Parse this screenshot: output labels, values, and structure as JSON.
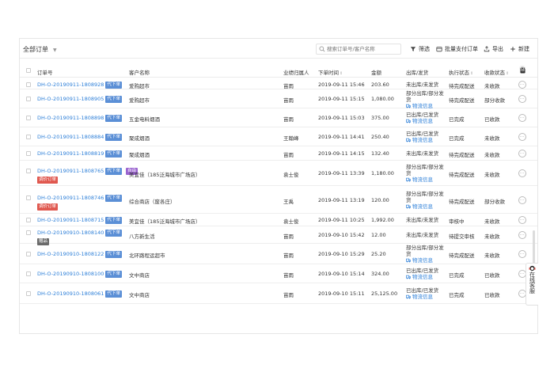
{
  "toolbar": {
    "filter_label": "全部订单",
    "search_placeholder": "搜索订单号/客户名称",
    "btn_filter": "筛选",
    "btn_batch_pay": "批量支付订单",
    "btn_export": "导出",
    "btn_new": "新建"
  },
  "columns": {
    "order_no": "订单号",
    "customer": "客户名称",
    "owner": "业绩归属人",
    "time": "下单时间",
    "amount": "金额",
    "ship": "出库/发货",
    "exec": "执行状态",
    "pay": "收款状态"
  },
  "logistics_label": "物流信息",
  "service_text": "在线客服",
  "colors": {
    "link": "#2d7fd8",
    "badge_blue": "#5b8fd6",
    "badge_red": "#e0584f",
    "badge_purple": "#9a63cf",
    "badge_dark": "#6a6a6a"
  },
  "rows": [
    {
      "order_no": "DH-O-20190911-1808928",
      "badge": "代下单",
      "customer": "爱购超市",
      "owner": "苗雨",
      "time": "2019-09-11 15:46",
      "amount": "203.60",
      "ship": "未出库/未发货",
      "exec": "待完成配送",
      "pay": "未收款"
    },
    {
      "order_no": "DH-O-20190911-1808905",
      "badge": "代下单",
      "customer": "爱购超市",
      "owner": "苗雨",
      "time": "2019-09-11 15:15",
      "amount": "1,080.00",
      "ship": "部分出库/部分发货",
      "exec": "待完成配送",
      "pay": "部分收款"
    },
    {
      "order_no": "DH-O-20190911-1808898",
      "badge": "代下单",
      "customer": "五金电料烟酒",
      "owner": "苗雨",
      "time": "2019-09-11 15:03",
      "amount": "375.00",
      "ship": "已出库/已发货",
      "exec": "已完成",
      "pay": "已收款"
    },
    {
      "order_no": "DH-O-20190911-1808884",
      "badge": "代下单",
      "customer": "聚成烟酒",
      "owner": "王翰峰",
      "time": "2019-09-11 14:41",
      "amount": "250.40",
      "ship": "已出库/已发货",
      "exec": "已完成",
      "pay": "未收款"
    },
    {
      "order_no": "DH-O-20190911-1808819",
      "badge": "代下单",
      "customer": "聚成烟酒",
      "owner": "苗雨",
      "time": "2019-09-11 14:15",
      "amount": "132.40",
      "ship": "未出库/未发货",
      "exec": "待完成配送",
      "pay": "未收款"
    },
    {
      "order_no": "DH-O-20190911-1808765",
      "badge": "代下单",
      "badge3": "自由",
      "tag2": "调价订单",
      "customer": "美宜佳（185泛海城市广场店）",
      "owner": "袁士俊",
      "time": "2019-09-11 13:39",
      "amount": "1,180.00",
      "ship": "部分出库/部分发货",
      "exec": "待完成配送",
      "pay": "未收款"
    },
    {
      "order_no": "DH-O-20190911-1808746",
      "badge": "代下单",
      "tag2": "调价订单",
      "customer": "综合商店（废各庄）",
      "owner": "王禹",
      "time": "2019-09-11 13:19",
      "amount": "120.00",
      "ship": "部分出库/部分发货",
      "exec": "待完成配送",
      "pay": "部分收款"
    },
    {
      "order_no": "DH-O-20190911-1808715",
      "badge": "代下单",
      "customer": "美宜佳（185泛海城市广场店）",
      "owner": "袁士俊",
      "time": "2019-09-11 10:25",
      "amount": "1,992.00",
      "ship": "未出库/未发货",
      "exec": "审核中",
      "pay": "未收款"
    },
    {
      "order_no": "DH-O-20190910-1808140",
      "badge": "代下单",
      "tag2": "赠品",
      "customer": "八方新生活",
      "owner": "苗雨",
      "time": "2019-09-10 15:42",
      "amount": "12.00",
      "ship": "未出库/未发货",
      "exec": "待提交审核",
      "pay": "未收款"
    },
    {
      "order_no": "DH-O-20190910-1808122",
      "badge": "代下单",
      "customer": "北环路程运超市",
      "owner": "苗雨",
      "time": "2019-09-10 15:29",
      "amount": "25.20",
      "ship": "部分出库/部分发货",
      "exec": "待完成配送",
      "pay": "未收款"
    },
    {
      "order_no": "DH-O-20190910-1808100",
      "badge": "代下单",
      "customer": "文中商店",
      "owner": "苗雨",
      "time": "2019-09-10 15:14",
      "amount": "324.00",
      "ship": "已出库/已发货",
      "exec": "已完成",
      "pay": "已收款"
    },
    {
      "order_no": "DH-O-20190910-1808061",
      "badge": "代下单",
      "customer": "文中商店",
      "owner": "苗雨",
      "time": "2019-09-10 15:11",
      "amount": "25,125.00",
      "ship": "已出库/已发货",
      "exec": "已完成",
      "pay": "已收款"
    }
  ]
}
